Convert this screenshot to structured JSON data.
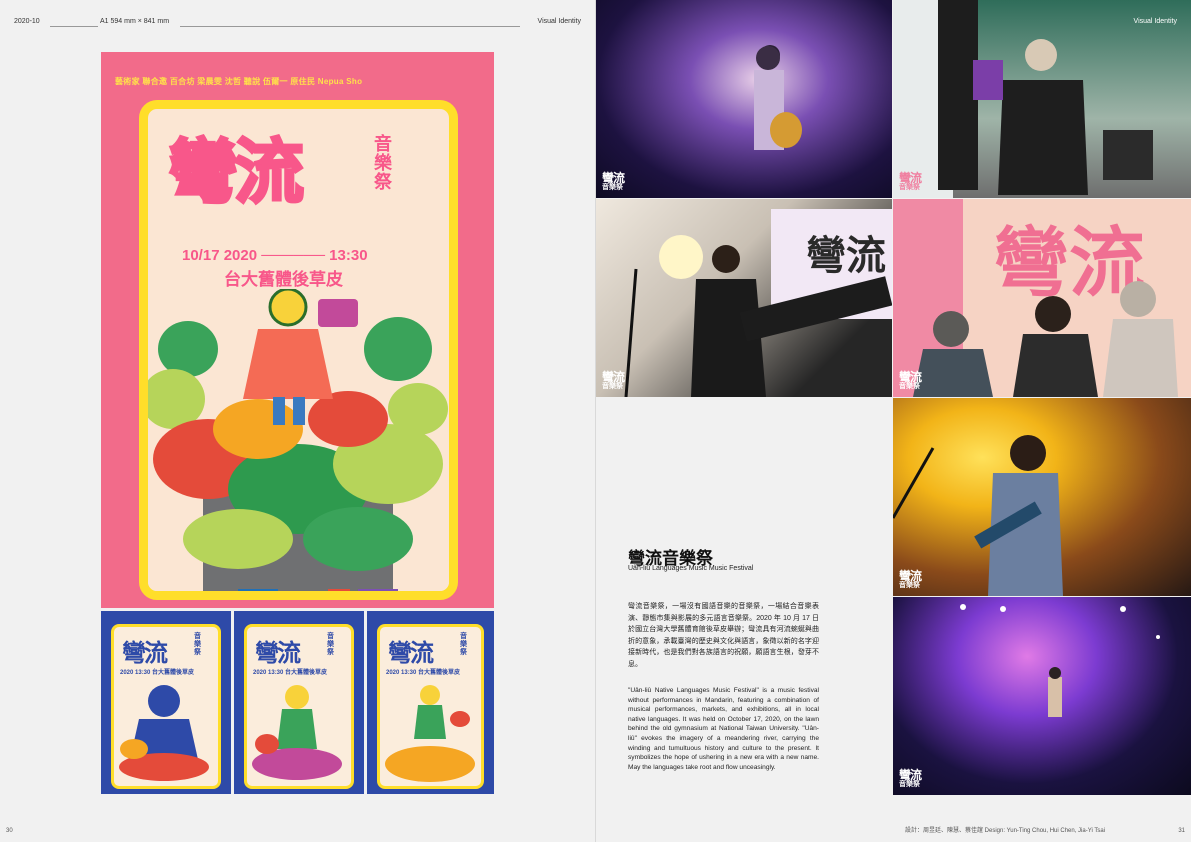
{
  "left_page": {
    "header": {
      "issue": "2020-10",
      "size": "A1 594 mm × 841 mm",
      "section": "Visual Identity"
    },
    "page_number": "30",
    "poster": {
      "top_line": "藝術家 聯合邀 百合坊 梁晨雯 沈哲 聽說 伍爾一 原住民 Nepua Sho",
      "title": "彎流",
      "subtitle": "音樂祭",
      "date": "10/17  2020 ────── 13:30",
      "venue": "台大舊體後草皮"
    },
    "mini_posters": [
      {
        "title": "彎流",
        "subtitle": "音樂祭",
        "date": "2020 13:30 台大舊體後草皮"
      },
      {
        "title": "彎流",
        "subtitle": "音樂祭",
        "date": "2020 13:30 台大舊體後草皮"
      },
      {
        "title": "彎流",
        "subtitle": "音樂祭",
        "date": "2020 13:30 台大舊體後草皮"
      }
    ]
  },
  "right_page": {
    "header": {
      "section": "Visual Identity"
    },
    "footer": "設計：周昱廷、陳慧、蔡佳誼 Design: Yun-Ting Chou, Hui Chen, Jia-Yi Tsai",
    "page_number": "31",
    "photo_logo": {
      "title": "彎流",
      "subtitle": "音樂祭"
    },
    "article": {
      "title": "彎流音樂祭",
      "subtitle": "Uân-liû Languages Music Music Festival",
      "body_zh": "彎流音樂祭，一場沒有國語音樂的音樂祭，一場結合音樂表演、靜態市集與影展的多元語言音樂祭。2020 年 10 月 17 日於國立台灣大學舊體育館後草皮舉辦；彎流具有河流蜿蜒與曲折的意象，承載臺灣的歷史與文化與語言，象徵以新的名字迎接新時代，也是我們對各族語言的祝願，願語言生根，發芽不息。",
      "body_en": "\"Uân-liû Native Languages Music Festival\" is a music festival without performances in Mandarin, featuring a combination of musical performances, markets, and exhibitions, all in local native languages. It was held on October 17, 2020, on the lawn behind the old gymnasium at National Taiwan University. \"Uân-liû\" evokes the imagery of a meandering river, carrying the winding and tumultuous history and culture to the present. It symbolizes the hope of ushering in a new era with a new name. May the languages take root and flow unceasingly."
    }
  },
  "colors": {
    "poster_pink": "#f26b8a",
    "poster_yellow": "#ffde2a",
    "mini_blue": "#2e4aa8"
  }
}
